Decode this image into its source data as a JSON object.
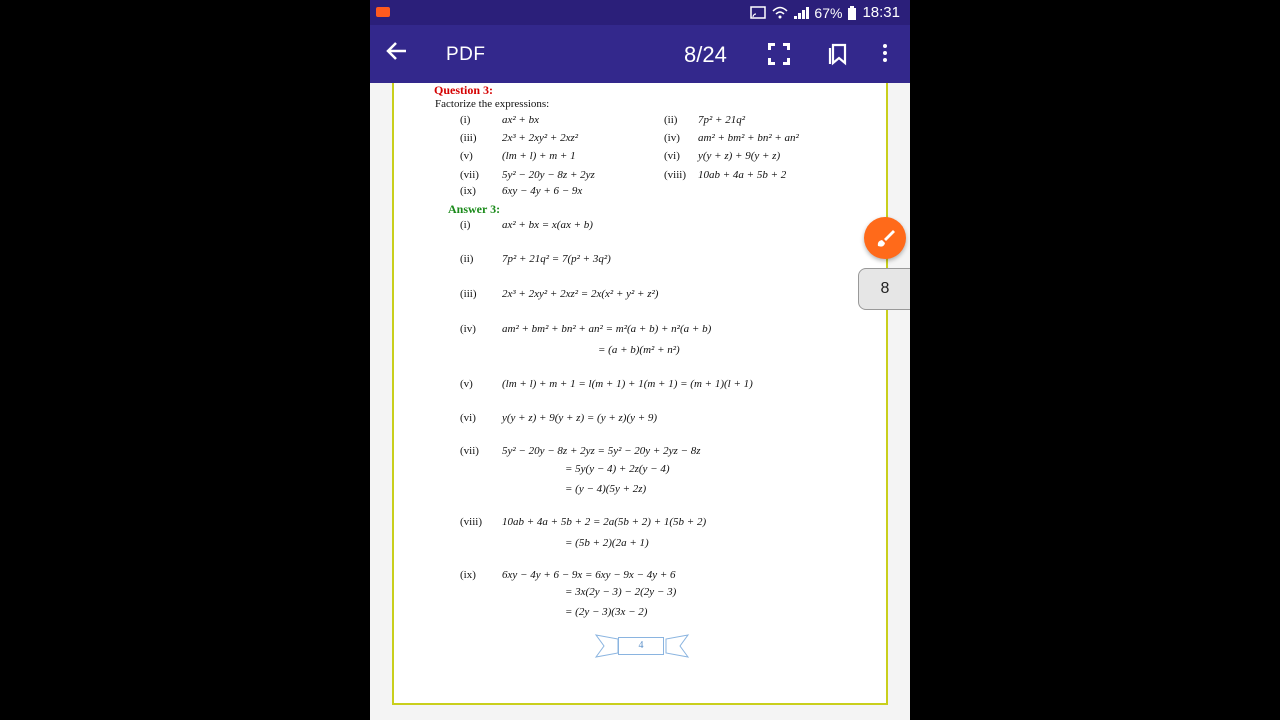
{
  "status": {
    "battery": "67%",
    "time": "18:31"
  },
  "appbar": {
    "title": "PDF",
    "page_indicator": "8/24"
  },
  "page_tab": "8",
  "question": {
    "heading": "Question 3:",
    "intro": "Factorize the expressions:",
    "items": [
      {
        "label": "(i)",
        "expr": "ax² + bx"
      },
      {
        "label": "(ii)",
        "expr": "7p² + 21q²"
      },
      {
        "label": "(iii)",
        "expr": "2x³ + 2xy² + 2xz²"
      },
      {
        "label": "(iv)",
        "expr": "am² + bm² + bn² + an²"
      },
      {
        "label": "(v)",
        "expr": "(lm + l) + m + 1"
      },
      {
        "label": "(vi)",
        "expr": "y(y + z) + 9(y + z)"
      },
      {
        "label": "(vii)",
        "expr": "5y² − 20y − 8z + 2yz"
      },
      {
        "label": "(viii)",
        "expr": "10ab + 4a + 5b + 2"
      },
      {
        "label": "(ix)",
        "expr": "6xy − 4y + 6 − 9x"
      }
    ]
  },
  "answer": {
    "heading": "Answer 3:",
    "items": [
      {
        "label": "(i)",
        "lines": [
          "ax² + bx = x(ax + b)"
        ]
      },
      {
        "label": "(ii)",
        "lines": [
          "7p² + 21q² = 7(p² + 3q²)"
        ]
      },
      {
        "label": "(iii)",
        "lines": [
          "2x³ + 2xy² + 2xz² = 2x(x² + y² + z²)"
        ]
      },
      {
        "label": "(iv)",
        "lines": [
          "am² + bm² + bn² + an² = m²(a + b) + n²(a + b)",
          "= (a + b)(m² + n²)"
        ]
      },
      {
        "label": "(v)",
        "lines": [
          "(lm + l) + m + 1 = l(m + 1) + 1(m + 1) = (m + 1)(l + 1)"
        ]
      },
      {
        "label": "(vi)",
        "lines": [
          "y(y + z) + 9(y + z) = (y + z)(y + 9)"
        ]
      },
      {
        "label": "(vii)",
        "lines": [
          "5y² − 20y − 8z + 2yz = 5y² − 20y + 2yz − 8z",
          "= 5y(y − 4) + 2z(y − 4)",
          "= (y − 4)(5y + 2z)"
        ]
      },
      {
        "label": "(viii)",
        "lines": [
          "10ab + 4a + 5b + 2 = 2a(5b + 2) + 1(5b + 2)",
          "= (5b + 2)(2a + 1)"
        ]
      },
      {
        "label": "(ix)",
        "lines": [
          "6xy − 4y + 6 − 9x = 6xy − 9x − 4y + 6",
          "= 3x(2y − 3) − 2(2y − 3)",
          "= (2y − 3)(3x − 2)"
        ]
      }
    ]
  },
  "footer_page_number": "4",
  "colors": {
    "statusbar": "#2b1f7a",
    "appbar": "#33288c",
    "accent": "#ff6a1a",
    "page_border": "#c9cf1c",
    "question_heading": "#d40000",
    "answer_heading": "#1a8a1a"
  }
}
